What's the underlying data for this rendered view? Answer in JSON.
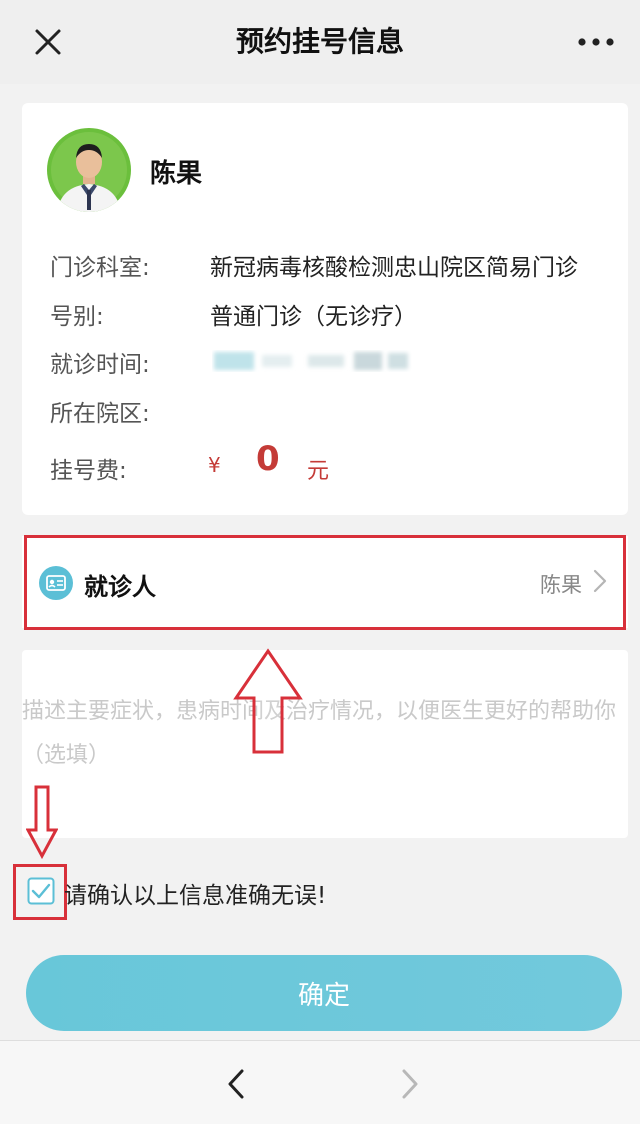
{
  "header": {
    "title": "预约挂号信息"
  },
  "doctor": {
    "name": "陈果"
  },
  "info": {
    "department_label": "门诊科室:",
    "department_value": "新冠病毒核酸检测忠山院区简易门诊",
    "type_label": "号别:",
    "type_value": "普通门诊（无诊疗）",
    "time_label": "就诊时间:",
    "campus_label": "所在院区:",
    "fee_label": "挂号费:",
    "fee_currency": "¥",
    "fee_amount": "0",
    "fee_unit": "元"
  },
  "patient": {
    "title": "就诊人",
    "value": "陈果"
  },
  "symptom": {
    "placeholder": "描述主要症状，患病时间及治疗情况，以便医生更好的帮助你（选填）"
  },
  "confirm": {
    "checked": true,
    "text": "请确认以上信息准确无误!"
  },
  "submit": {
    "label": "确定"
  },
  "colors": {
    "accent": "#6cc8da",
    "fee": "#c43b37",
    "highlight": "#d8303a"
  }
}
